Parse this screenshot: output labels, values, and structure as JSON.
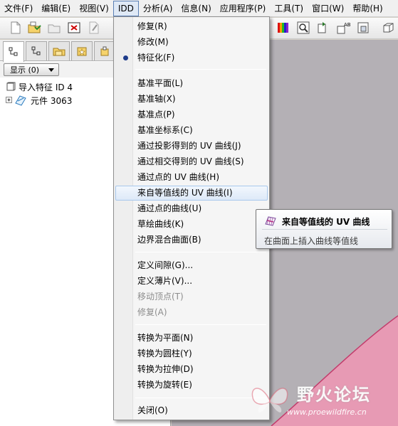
{
  "menubar": {
    "items": [
      {
        "label": "文件(F)"
      },
      {
        "label": "编辑(E)"
      },
      {
        "label": "视图(V)"
      },
      {
        "label": "IDD"
      },
      {
        "label": "分析(A)"
      },
      {
        "label": "信息(N)"
      },
      {
        "label": "应用程序(P)"
      },
      {
        "label": "工具(T)"
      },
      {
        "label": "窗口(W)"
      },
      {
        "label": "帮助(H)"
      }
    ],
    "active_index": 3
  },
  "model_tree": {
    "show_button": "显示 (0)",
    "rows": [
      {
        "label": "导入特征 ID 4"
      },
      {
        "label": "元件 3063"
      }
    ]
  },
  "idd_menu": {
    "items": [
      {
        "label": "修复(R)",
        "enabled": true
      },
      {
        "label": "修改(M)",
        "enabled": true
      },
      {
        "label": "特征化(F)",
        "enabled": true,
        "checked": true
      },
      {
        "label": "基准平面(L)",
        "enabled": true
      },
      {
        "label": "基准轴(X)",
        "enabled": true
      },
      {
        "label": "基准点(P)",
        "enabled": true
      },
      {
        "label": "基准坐标系(C)",
        "enabled": true
      },
      {
        "label": "通过投影得到的 UV 曲线(J)",
        "enabled": true
      },
      {
        "label": "通过相交得到的 UV 曲线(S)",
        "enabled": true
      },
      {
        "label": "通过点的 UV 曲线(H)",
        "enabled": true
      },
      {
        "label": "来自等值线的 UV 曲线(I)",
        "enabled": true,
        "highlighted": true
      },
      {
        "label": "通过点的曲线(U)",
        "enabled": true
      },
      {
        "label": "草绘曲线(K)",
        "enabled": true
      },
      {
        "label": "边界混合曲面(B)",
        "enabled": true
      },
      {
        "label": "定义间隙(G)...",
        "enabled": true
      },
      {
        "label": "定义薄片(V)...",
        "enabled": true
      },
      {
        "label": "移动顶点(T)",
        "enabled": false
      },
      {
        "label": "修复(A)",
        "enabled": false
      },
      {
        "label": "转换为平面(N)",
        "enabled": true
      },
      {
        "label": "转换为圆柱(Y)",
        "enabled": true
      },
      {
        "label": "转换为拉伸(D)",
        "enabled": true
      },
      {
        "label": "转换为旋转(E)",
        "enabled": true
      },
      {
        "label": "关闭(O)",
        "enabled": true
      }
    ]
  },
  "tooltip": {
    "title": "来自等值线的 UV 曲线",
    "description": "在曲面上插入曲线等值线"
  },
  "watermark": {
    "text": "野火论坛",
    "url": "www.proewildfire.cn"
  },
  "colors": {
    "menu_bg": "#f5f5f5",
    "highlight_border": "#a8c8ec",
    "surface_pink": "#e79ab4",
    "surface_edge": "#c23c6c",
    "graphics_bg": "#b4b0b5"
  }
}
